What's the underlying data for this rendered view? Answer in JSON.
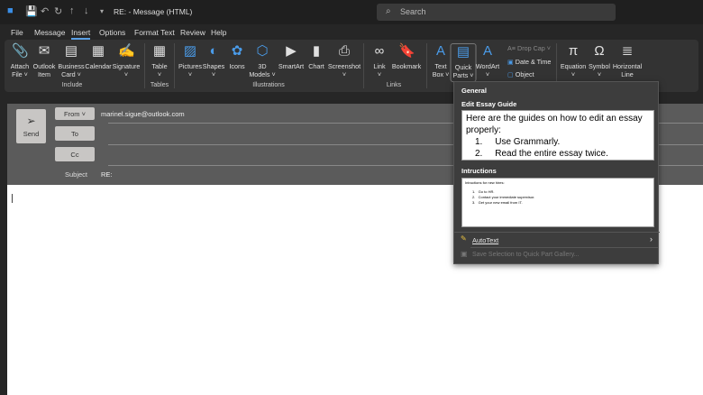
{
  "titlebar": {
    "title": "RE:  -  Message (HTML)",
    "search_placeholder": "Search"
  },
  "menu": [
    "File",
    "Message",
    "Insert",
    "Options",
    "Format Text",
    "Review",
    "Help"
  ],
  "ribbon": {
    "include": [
      "Attach\nFile ˅",
      "Outlook\nItem",
      "Business\nCard ˅",
      "Calendar",
      "Signature\n˅"
    ],
    "include_label": "Include",
    "tables": [
      "Table\n˅"
    ],
    "tables_label": "Tables",
    "illustrations": [
      "Pictures\n˅",
      "Shapes\n˅",
      "Icons",
      "3D\nModels ˅",
      "SmartArt",
      "Chart",
      "Screenshot\n˅"
    ],
    "illustrations_label": "Illustrations",
    "links": [
      "Link\n˅",
      "Bookmark"
    ],
    "links_label": "Links",
    "text": [
      "Text\nBox ˅",
      "Quick\nParts ˅",
      "WordArt\n˅"
    ],
    "text_small": [
      "Drop Cap ˅",
      "Date & Time",
      "Object"
    ],
    "symbols": [
      "Equation\n˅",
      "Symbol\n˅",
      "Horizontal\nLine"
    ]
  },
  "compose": {
    "send": "Send",
    "from": "From ˅",
    "from_value": "marinel.sigue@outlook.com",
    "to": "To",
    "cc": "Cc",
    "subject_label": "Subject",
    "subject_value": "RE:"
  },
  "quickparts": {
    "general": "General",
    "entry1_title": "Edit Essay Guide",
    "entry1_text": "Here are the guides on how to edit an essay properly:",
    "entry1_items": [
      "Use Grammarly.",
      "Read the entire essay twice."
    ],
    "entry2_title": "Intructions",
    "entry2_text": "Intructions for new hires:",
    "entry2_items": [
      "Go to HR.",
      "Contact your immediate supervisor.",
      "Get your new email from IT."
    ],
    "autotext": "AutoText",
    "save_selection": "Save Selection to Quick Part Gallery..."
  }
}
